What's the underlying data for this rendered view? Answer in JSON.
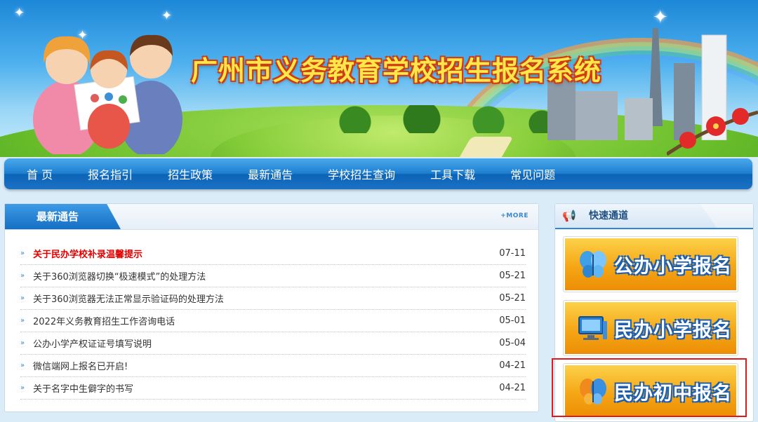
{
  "banner": {
    "title": "广州市义务教育学校招生报名系统"
  },
  "nav": {
    "items": [
      "首 页",
      "报名指引",
      "招生政策",
      "最新通告",
      "学校招生查询",
      "工具下载",
      "常见问题"
    ]
  },
  "news": {
    "header": "最新通告",
    "more_label": "+MORE",
    "items": [
      {
        "title": "关于民办学校补录温馨提示",
        "date": "07-11"
      },
      {
        "title": "关于360浏览器切换“极速模式”的处理方法",
        "date": "05-21"
      },
      {
        "title": "关于360浏览器无法正常显示验证码的处理方法",
        "date": "05-21"
      },
      {
        "title": "2022年义务教育招生工作咨询电话",
        "date": "05-01"
      },
      {
        "title": "公办小学产权证证号填写说明",
        "date": "05-04"
      },
      {
        "title": "微信端网上报名已开启!",
        "date": "04-21"
      },
      {
        "title": "关于名字中生僻字的书写",
        "date": "04-21"
      }
    ]
  },
  "quick": {
    "header": "快速通道",
    "buttons": [
      {
        "label": "公办小学报名",
        "icon": "butterfly-icon"
      },
      {
        "label": "民办小学报名",
        "icon": "computer-icon"
      },
      {
        "label": "民办初中报名",
        "icon": "butterfly-icon"
      }
    ]
  },
  "colors": {
    "nav_blue": "#1f7fd0",
    "button_orange": "#f5a615",
    "hot_red": "#e10000",
    "highlight_red": "#e01a1a"
  }
}
